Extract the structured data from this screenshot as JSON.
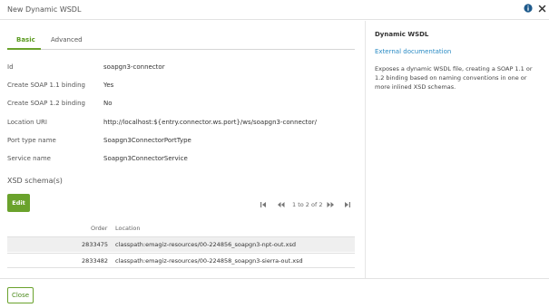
{
  "dialog": {
    "title": "New Dynamic WSDL"
  },
  "header_icons": [
    "info-icon",
    "close-icon"
  ],
  "tabs": [
    {
      "label": "Basic",
      "active": true
    },
    {
      "label": "Advanced",
      "active": false
    }
  ],
  "fields": [
    {
      "label": "Id",
      "value": "soapgn3-connector"
    },
    {
      "label": "Create SOAP 1.1 binding",
      "value": "Yes"
    },
    {
      "label": "Create SOAP 1.2 binding",
      "value": "No"
    },
    {
      "label": "Location URI",
      "value": "http://localhost:${entry.connector.ws.port}/ws/soapgn3-connector/"
    },
    {
      "label": "Port type name",
      "value": "Soapgn3ConnectorPortType"
    },
    {
      "label": "Service name",
      "value": "Soapgn3ConnectorService"
    }
  ],
  "xsd": {
    "section_title": "XSD schema(s)",
    "edit_label": "Edit",
    "pager_text": "1 to 2 of 2",
    "columns": {
      "order": "Order",
      "location": "Location"
    },
    "rows": [
      {
        "order": "2833475",
        "location": "classpath:emagiz-resources/00-224856_soapgn3-npt-out.xsd"
      },
      {
        "order": "2833482",
        "location": "classpath:emagiz-resources/00-224858_soapgn3-sierra-out.xsd"
      }
    ]
  },
  "side_panel": {
    "title": "Dynamic WSDL",
    "link": "External documentation",
    "description": "Exposes a dynamic WSDL file, creating a SOAP 1.1 or 1.2 binding based on naming conventions in one or more inlined XSD schemas."
  },
  "footer": {
    "close_label": "Close"
  },
  "colors": {
    "accent": "#6aa22c",
    "link": "#2a8bc4",
    "info_icon": "#1e5a8c"
  }
}
